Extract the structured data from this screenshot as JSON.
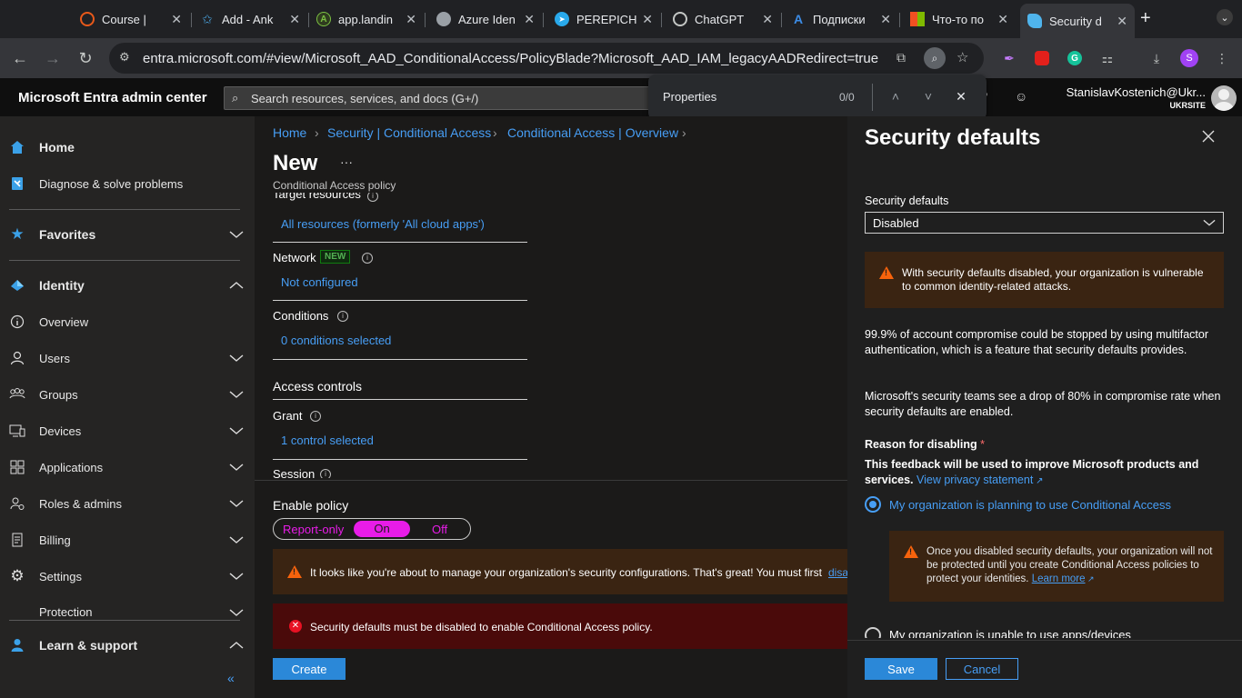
{
  "browser": {
    "tabs": [
      {
        "title": "Course |",
        "icon": "course-favicon",
        "color": "#e8591a"
      },
      {
        "title": "Add - Ank",
        "icon": "star-favicon",
        "color": "#4aa3df"
      },
      {
        "title": "app.landin",
        "icon": "app-favicon",
        "color": "#7bc043"
      },
      {
        "title": "Azure Iden",
        "icon": "globe-favicon",
        "color": "#9aa0a6"
      },
      {
        "title": "PEREPICH",
        "icon": "telegram-favicon",
        "color": "#29a9eb"
      },
      {
        "title": "ChatGPT",
        "icon": "chatgpt-favicon",
        "color": "#c4c7c5"
      },
      {
        "title": "Подписки",
        "icon": "azure-favicon",
        "color": "#3c8ce6"
      },
      {
        "title": "Что-то по",
        "icon": "microsoft-favicon",
        "color": "#f25022"
      },
      {
        "title": "Security d",
        "icon": "entra-favicon",
        "color": "#4fb4ec"
      }
    ],
    "new_tab": "+",
    "url": "entra.microsoft.com/#view/Microsoft_AAD_ConditionalAccess/PolicyBlade?Microsoft_AAD_IAM_legacyAADRedirect=true",
    "profile_initial": "S"
  },
  "find": {
    "query": "Properties",
    "count": "0/0"
  },
  "header": {
    "brand": "Microsoft Entra admin center",
    "search_placeholder": "Search resources, services, and docs (G+/)",
    "user_name": "StanislavKostenich@Ukr...",
    "tenant": "UKRSITE"
  },
  "sidebar": {
    "items": [
      {
        "label": "Home",
        "icon": "home-icon",
        "major": true
      },
      {
        "label": "Diagnose & solve problems",
        "icon": "diagnose-icon"
      },
      {
        "label": "Favorites",
        "icon": "star-icon",
        "major": true
      },
      {
        "label": "Identity",
        "icon": "identity-icon",
        "major": true
      },
      {
        "label": "Overview",
        "icon": "info-icon"
      },
      {
        "label": "Users",
        "icon": "user-icon"
      },
      {
        "label": "Groups",
        "icon": "groups-icon"
      },
      {
        "label": "Devices",
        "icon": "devices-icon"
      },
      {
        "label": "Applications",
        "icon": "applications-icon"
      },
      {
        "label": "Roles & admins",
        "icon": "roles-icon"
      },
      {
        "label": "Billing",
        "icon": "billing-icon"
      },
      {
        "label": "Settings",
        "icon": "gear-icon"
      },
      {
        "label": "Protection",
        "icon": "protection-icon"
      },
      {
        "label": "Learn & support",
        "icon": "learn-icon",
        "major": true
      }
    ],
    "collapse": "«"
  },
  "main": {
    "breadcrumb": [
      "Home",
      "Security | Conditional Access",
      "Conditional Access | Overview"
    ],
    "title": "New",
    "more": "···",
    "subtitle": "Conditional Access policy",
    "target_label": "Target resources",
    "target_value": "All resources (formerly 'All cloud apps')",
    "network_label": "Network",
    "network_badge": "NEW",
    "network_value": "Not configured",
    "conditions_label": "Conditions",
    "conditions_value": "0 conditions selected",
    "access_controls": "Access controls",
    "grant_label": "Grant",
    "grant_value": "1 control selected",
    "session_label": "Session",
    "enable_policy": "Enable policy",
    "toggle": [
      "Report-only",
      "On",
      "Off"
    ],
    "toggle_color": "#e81ce8",
    "warning": "It looks like you're about to manage your organization's security configurations. That's great! You must first",
    "warning_link": "disa",
    "error": "Security defaults must be disabled to enable Conditional Access policy.",
    "create": "Create"
  },
  "panel": {
    "title": "Security defaults",
    "field_label": "Security defaults",
    "field_value": "Disabled",
    "warning": "With security defaults disabled, your organization is vulnerable to common identity-related attacks.",
    "para1": "99.9% of account compromise could be stopped by using multifactor authentication, which is a feature that security defaults provides.",
    "para2": "Microsoft's security teams see a drop of 80% in compromise rate when security defaults are enabled.",
    "reason_label": "Reason for disabling",
    "required_mark": "*",
    "feedback": "This feedback will be used to improve Microsoft products and services.",
    "privacy_link": "View privacy statement",
    "option1": "My organization is planning to use Conditional Access",
    "inner_warning": "Once you disabled security defaults, your organization will not be protected until you create Conditional Access policies to protect your identities.",
    "learn_more": "Learn more",
    "option2": "My organization is unable to use apps/devices",
    "save": "Save",
    "cancel": "Cancel"
  },
  "colors": {
    "accent": "#479ef5",
    "primary_button": "#2b88d8",
    "warning_bg": "#3a2412",
    "error_bg": "#4a0a0a",
    "badge_green": "#107c10"
  }
}
